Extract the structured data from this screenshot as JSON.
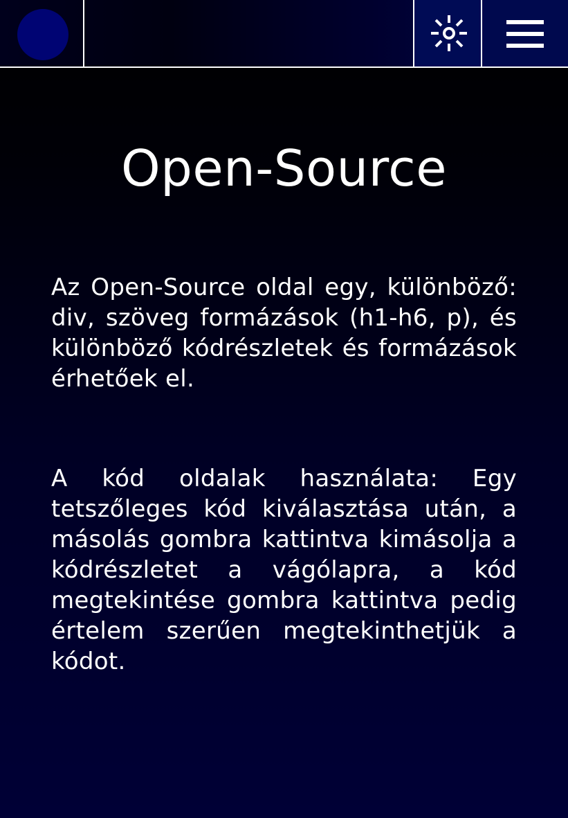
{
  "header": {
    "logo_icon": "circle-logo-icon",
    "theme_toggle_icon": "sun-icon",
    "menu_icon": "hamburger-menu-icon"
  },
  "main": {
    "title": "Open-Source",
    "paragraphs": [
      "Az Open-Source oldal egy, különböző: div, szöveg formázások (h1-h6, p), és különböző kódrészletek és formázások érhetőek el.",
      "A kód oldalak használata: Egy tetszőleges kód kiválasztása után, a másolás gombra kattintva kimásolja a kódrészletet a vágólapra, a kód megtekintése gombra kattintva pedig értelem szerűen megtekinthetjük a kódot."
    ]
  },
  "colors": {
    "background_top": "#000000",
    "background_bottom": "#000036",
    "logo_fill": "#000473",
    "header_accent": "#00094e",
    "text": "#ffffff"
  }
}
